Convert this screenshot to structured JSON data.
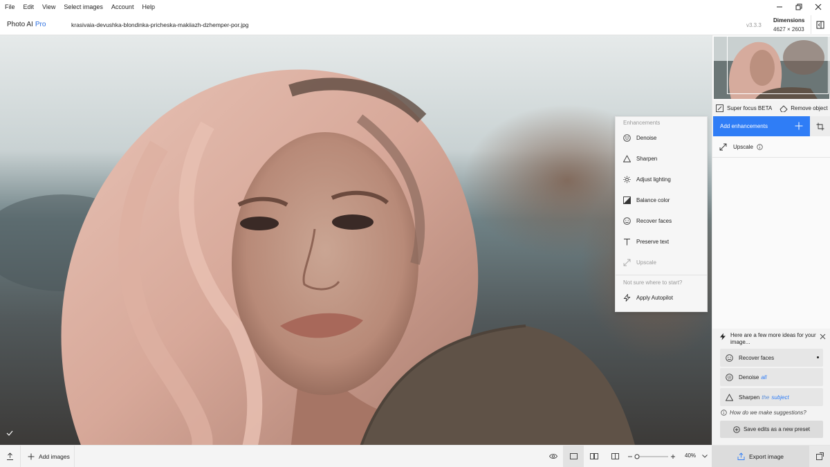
{
  "menubar": {
    "items": [
      "File",
      "Edit",
      "View",
      "Select images",
      "Account",
      "Help"
    ]
  },
  "header": {
    "app_name": "Photo AI",
    "app_tier": "Pro",
    "filename": "krasivaia-devushka-blondinka-pricheska-makiiazh-dzhemper-por.jpg",
    "version": "v3.3.3",
    "dimensions_label": "Dimensions",
    "dimensions_value": "4627 × 2603"
  },
  "enhancements_menu": {
    "section_title": "Enhancements",
    "items": [
      {
        "label": "Denoise",
        "icon": "denoise-icon",
        "enabled": true
      },
      {
        "label": "Sharpen",
        "icon": "sharpen-icon",
        "enabled": true
      },
      {
        "label": "Adjust lighting",
        "icon": "lighting-icon",
        "enabled": true
      },
      {
        "label": "Balance color",
        "icon": "balance-color-icon",
        "enabled": true
      },
      {
        "label": "Recover faces",
        "icon": "face-icon",
        "enabled": true
      },
      {
        "label": "Preserve text",
        "icon": "text-icon",
        "enabled": true
      },
      {
        "label": "Upscale",
        "icon": "upscale-icon",
        "enabled": false
      }
    ],
    "help_title": "Not sure where to start?",
    "autopilot_label": "Apply Autopilot"
  },
  "right_panel": {
    "super_focus_label": "Super focus BETA",
    "remove_object_label": "Remove object",
    "add_enhancements_label": "Add enhancements",
    "upscale_label": "Upscale",
    "ideas_title": "Here are a few more ideas for your image...",
    "suggestions": [
      {
        "label": "Recover faces",
        "modifier": "",
        "modifier2": "",
        "icon": "face-icon"
      },
      {
        "label": "Denoise",
        "modifier": "all",
        "modifier2": "",
        "icon": "denoise-icon"
      },
      {
        "label": "Sharpen",
        "modifier": "the",
        "modifier2": "subject",
        "icon": "sharpen-icon"
      }
    ],
    "how_label": "How do we make suggestions?",
    "save_preset_label": "Save edits as a new preset"
  },
  "bottombar": {
    "add_images_label": "Add images",
    "zoom_level": "40%",
    "export_label": "Export image"
  },
  "colors": {
    "accent": "#2f7df6",
    "panel_bg": "#f3f3f3"
  }
}
